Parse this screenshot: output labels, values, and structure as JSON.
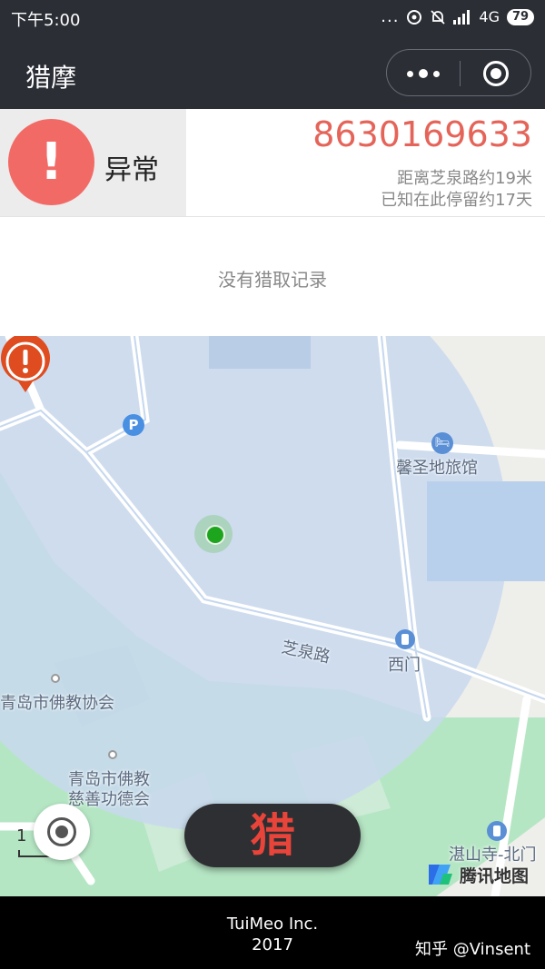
{
  "status_bar": {
    "time": "下午5:00",
    "dots": "...",
    "network": "4G",
    "battery": "79"
  },
  "nav": {
    "title": "猎摩",
    "more_icon": "more-dots-icon",
    "close_icon": "target-close-icon"
  },
  "device": {
    "alert_symbol": "!",
    "status_label": "异常",
    "id": "8630169633",
    "distance_text": "距离芝泉路约19米",
    "stay_text": "已知在此停留约17天",
    "empty_text": "没有猎取记录",
    "status_color": "#f26a66",
    "id_color": "#e56459"
  },
  "map": {
    "labels": {
      "hotel": "馨圣地旅馆",
      "road": "芝泉路",
      "gate": "西门",
      "assoc": "青岛市佛教协会",
      "charity_line1": "青岛市佛教",
      "charity_line2": "慈善功德会",
      "temple": "湛山寺-北门"
    },
    "parking_symbol": "P",
    "scale_label": "1",
    "brand": "腾讯地图",
    "circle_color": "#c8d8ef",
    "green_color": "#b5e6c4"
  },
  "hunt_button": {
    "label": "猎",
    "color": "#e8443a"
  },
  "footer": {
    "company": "TuiMeo Inc.",
    "year": "2017",
    "watermark": "知乎 @Vinsent"
  }
}
